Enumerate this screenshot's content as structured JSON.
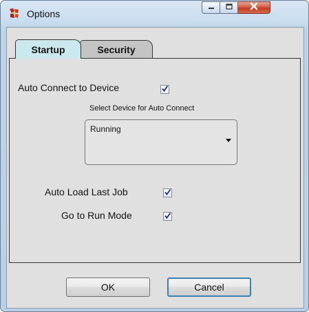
{
  "window": {
    "title": "Options"
  },
  "tabs": [
    {
      "label": "Startup",
      "selected": true
    },
    {
      "label": "Security",
      "selected": false
    }
  ],
  "startup": {
    "auto_connect": {
      "label": "Auto Connect to Device",
      "checked": true
    },
    "device_select": {
      "caption": "Select Device for Auto Connect",
      "value": "Running"
    },
    "auto_load_last_job": {
      "label": "Auto Load Last Job",
      "checked": true
    },
    "go_to_run_mode": {
      "label": "Go to Run Mode",
      "checked": true
    }
  },
  "buttons": {
    "ok": "OK",
    "cancel": "Cancel"
  },
  "icons": {
    "app": "gear-app-icon",
    "minimize": "minimize-icon",
    "maximize": "maximize-icon",
    "close": "close-icon",
    "check": "checkmark-icon",
    "dropdown": "chevron-down-icon"
  },
  "colors": {
    "selected_tab": "#cbe8ee",
    "close_button": "#c23b22",
    "check": "#1a2d8f"
  }
}
